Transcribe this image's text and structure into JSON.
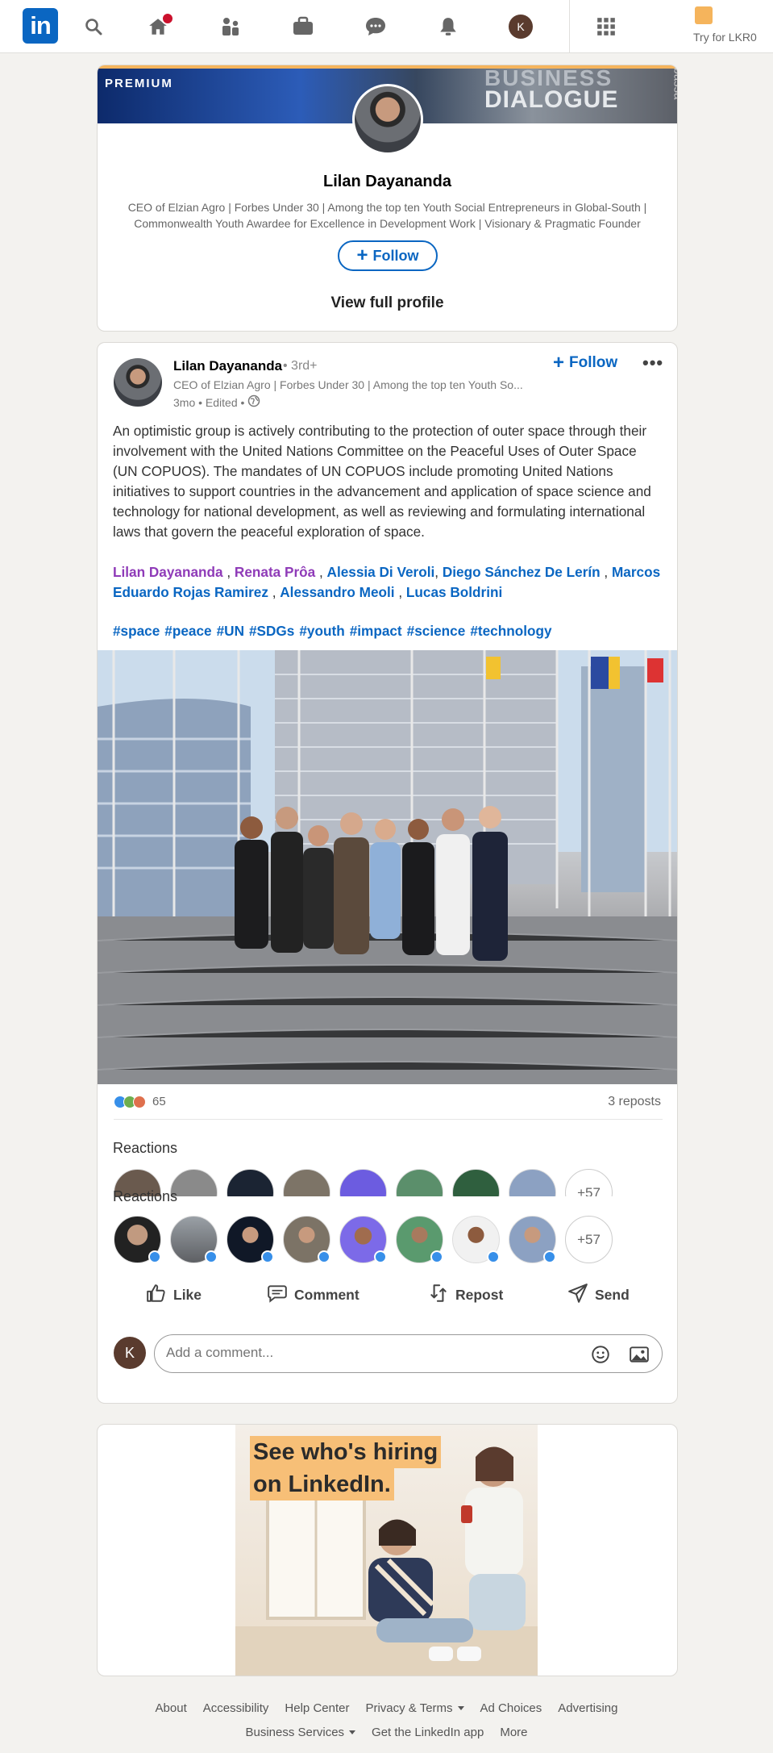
{
  "nav": {
    "logo": "in",
    "icons": [
      "search-icon",
      "home-icon",
      "my-network-icon",
      "jobs-icon",
      "messaging-icon",
      "notifications-icon",
      "me-avatar",
      "work-grid-icon"
    ],
    "avatar_letter": "K",
    "premium_label": "Try for LKR0",
    "brand_color": "#0a66c2",
    "notification_color": "#cb112d"
  },
  "profile_card": {
    "banner_label": "PREMIUM",
    "banner_text_1": "BUSINESS",
    "banner_text_2": "DIALOGUE",
    "banner_text_3": "bassa",
    "name": "Lilan Dayananda",
    "headline": "CEO of Elzian Agro | Forbes Under 30 | Among the top ten Youth Social Entrepreneurs in Global-South | Commonwealth Youth Awardee for Excellence in Development Work | Visionary & Pragmatic Founder",
    "follow_label": "Follow",
    "view_profile_label": "View full profile"
  },
  "post": {
    "author": "Lilan Dayananda",
    "degree": "• 3rd+",
    "headline": "CEO of Elzian Agro | Forbes Under 30 | Among the top ten Youth So...",
    "meta": "3mo • Edited •",
    "follow_label": "Follow",
    "more_label": "•••",
    "text": "An optimistic group is actively contributing to the protection of outer space through their involvement with the United Nations Committee on the Peaceful Uses of Outer Space (UN COPUOS). The mandates of UN COPUOS include promoting United Nations initiatives to support countries in the advancement and application of space science and technology for national development, as well as reviewing and formulating international laws that govern the peaceful exploration of space.",
    "mentions": [
      "Lilan Dayananda",
      "Renata Prôa",
      "Alessia Di Veroli",
      "Diego Sánchez De Lerín",
      "Marcos Eduardo Rojas Ramirez",
      "Alessandro Meoli",
      "Lucas Boldrini"
    ],
    "hashtags": [
      "#space",
      "#peace",
      "#UN",
      "#SDGs",
      "#youth",
      "#impact",
      "#science",
      "#technology"
    ],
    "reaction_count": "65",
    "reposts": "3 reposts",
    "reactions_title": "Reactions",
    "more_reactors": "+57",
    "actions": {
      "like": "Like",
      "comment": "Comment",
      "repost": "Repost",
      "send": "Send"
    },
    "comment_avatar_letter": "K",
    "comment_placeholder": "Add a comment..."
  },
  "ad": {
    "line1": "See who's hiring",
    "line2": "on LinkedIn."
  },
  "footer": {
    "row1": [
      "About",
      "Accessibility",
      "Help Center",
      "Privacy & Terms",
      "Ad Choices",
      "Advertising"
    ],
    "row2": [
      "Business Services",
      "Get the LinkedIn app",
      "More"
    ]
  }
}
